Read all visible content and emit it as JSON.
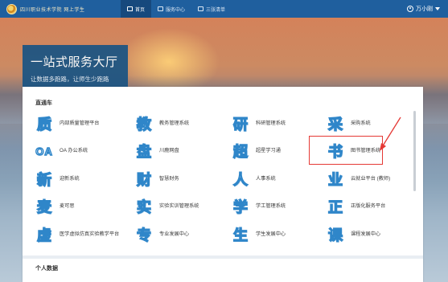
{
  "header": {
    "logo_text": "四川职业技术学院 网上学生",
    "nav": [
      {
        "label": "首页",
        "icon": "home-icon",
        "active": true
      },
      {
        "label": "服务中心",
        "icon": "service-icon",
        "active": false
      },
      {
        "label": "三张清单",
        "icon": "list-icon",
        "active": false
      }
    ],
    "user": {
      "name": "万小刚"
    }
  },
  "hero": {
    "title": "一站式服务大厅",
    "subtitle": "让数据多跑路，让师生少跑路"
  },
  "sections": {
    "direct": "直通车",
    "personal": "个人数据"
  },
  "apps": [
    {
      "glyph": "质",
      "label": "内部质量管理平台"
    },
    {
      "glyph": "教",
      "label": "教务管理系统"
    },
    {
      "glyph": "研",
      "label": "科研管理系统"
    },
    {
      "glyph": "采",
      "label": "采购系统"
    },
    {
      "glyph": "OA",
      "label": "OA 办公系统"
    },
    {
      "glyph": "盘",
      "label": "川鹿网盘"
    },
    {
      "glyph": "超",
      "label": "超星学习通"
    },
    {
      "glyph": "书",
      "label": "图书管理系统"
    },
    {
      "glyph": "新",
      "label": "迎新系统"
    },
    {
      "glyph": "财",
      "label": "智慧财务"
    },
    {
      "glyph": "人",
      "label": "人事系统"
    },
    {
      "glyph": "业",
      "label": "云就业平台 (教师)"
    },
    {
      "glyph": "麦",
      "label": "麦可思"
    },
    {
      "glyph": "实",
      "label": "实验实训管理系统"
    },
    {
      "glyph": "学",
      "label": "学工管理系统"
    },
    {
      "glyph": "正",
      "label": "正版化服务平台"
    },
    {
      "glyph": "虚",
      "label": "医学虚拟仿真实验教学平台"
    },
    {
      "glyph": "专",
      "label": "专业发展中心"
    },
    {
      "glyph": "生",
      "label": "学生发展中心"
    },
    {
      "glyph": "课",
      "label": "课程发展中心"
    }
  ],
  "colors": {
    "header": "#1f5f9e",
    "accent": "#2f86c9",
    "annotation": "#e53935"
  }
}
